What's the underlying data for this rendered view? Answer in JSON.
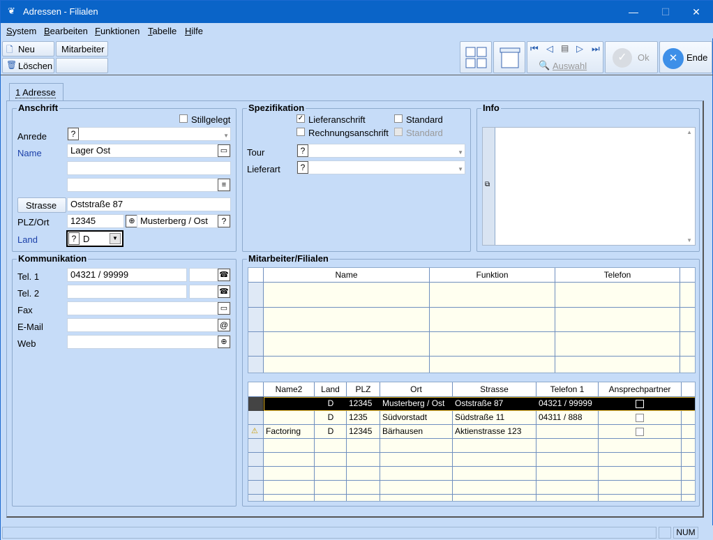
{
  "window": {
    "title": "Adressen - Filialen",
    "minimize": "—",
    "maximize": "☐",
    "close": "✕"
  },
  "menu": [
    {
      "label": "System",
      "u": "S",
      "rest": "ystem"
    },
    {
      "label": "Bearbeiten",
      "u": "B",
      "rest": "earbeiten"
    },
    {
      "label": "Funktionen",
      "u": "F",
      "rest": "unktionen"
    },
    {
      "label": "Tabelle",
      "u": "T",
      "rest": "abelle"
    },
    {
      "label": "Hilfe",
      "u": "H",
      "rest": "ilfe"
    }
  ],
  "toolbar": {
    "new": "Neu",
    "employee": "Mitarbeiter",
    "delete": "Löschen",
    "select": "Auswahl",
    "ok": "Ok",
    "end": "Ende"
  },
  "tab": {
    "label": "1 Adresse"
  },
  "anschrift": {
    "title": "Anschrift",
    "stillgelegt": "Stillgelegt",
    "anrede_label": "Anrede",
    "anrede_q": "?",
    "name_label": "Name",
    "name1": "Lager Ost",
    "name2": "",
    "name3": "",
    "strasse_button": "Strasse",
    "strasse": "Oststraße 87",
    "plzort_label": "PLZ/Ort",
    "plz": "12345",
    "ort": "Musterberg / Ost",
    "ort_q": "?",
    "land_label": "Land",
    "land_q": "?",
    "land": "D"
  },
  "kommunikation": {
    "title": "Kommunikation",
    "tel1_label": "Tel. 1",
    "tel1": "04321 / 99999",
    "tel2_label": "Tel. 2",
    "tel2": "",
    "fax_label": "Fax",
    "fax": "",
    "email_label": "E-Mail",
    "email": "",
    "web_label": "Web",
    "web": "",
    "at": "@"
  },
  "spezifikation": {
    "title": "Spezifikation",
    "lieferanschrift": "Lieferanschrift",
    "lieferanschrift_checked": true,
    "standard1": "Standard",
    "rechnungsanschrift": "Rechnungsanschrift",
    "standard2": "Standard",
    "tour_label": "Tour",
    "tour_q": "?",
    "lieferart_label": "Lieferart",
    "lieferart_q": "?"
  },
  "info": {
    "title": "Info"
  },
  "mitarbeiter": {
    "title": "Mitarbeiter/Filialen",
    "columns": [
      "Name",
      "Funktion",
      "Telefon"
    ]
  },
  "filialen": {
    "columns": [
      "Name2",
      "Land",
      "PLZ",
      "Ort",
      "Strasse",
      "Telefon 1",
      "Ansprechpartner"
    ],
    "rows": [
      {
        "name2": "",
        "land": "D",
        "plz": "12345",
        "ort": "Musterberg / Ost",
        "strasse": "Oststraße 87",
        "tel": "04321 / 99999",
        "selected": true
      },
      {
        "name2": "",
        "land": "D",
        "plz": "1235",
        "ort": "Südvorstadt",
        "strasse": "Südstraße 11",
        "tel": "04311 / 888",
        "selected": false
      },
      {
        "name2": "Factoring",
        "land": "D",
        "plz": "12345",
        "ort": "Bärhausen",
        "strasse": "Aktienstrasse 123",
        "tel": "",
        "selected": false
      }
    ]
  },
  "status": {
    "num": "NUM"
  }
}
